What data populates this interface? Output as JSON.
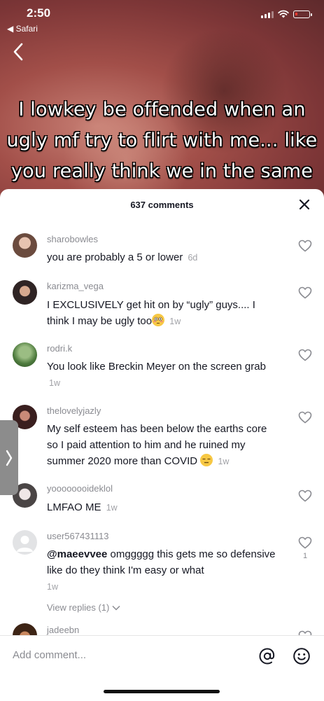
{
  "status_bar": {
    "time": "2:50",
    "back_app": "◀ Safari"
  },
  "video": {
    "caption": "I lowkey be offended when an ugly mf try to flirt with me... like you really think we in the same league?! Tough"
  },
  "comments_sheet": {
    "count_label": "637 comments",
    "comments": [
      {
        "username": "sharobowles",
        "text": "you are probably a 5 or lower",
        "time": "6d"
      },
      {
        "username": "karizma_vega",
        "text": "I EXCLUSIVELY get hit on by “ugly” guys.... I think I may be ugly too",
        "emoji": "flushed-face-emoji",
        "time": "1w"
      },
      {
        "username": "rodri.k",
        "text": "You look like Breckin Meyer on the screen grab",
        "time": "1w"
      },
      {
        "username": "thelovelyjazly",
        "text": "My self esteem has been below the earths core so I paid attention to him and he ruined my summer 2020 more than COVID",
        "emoji": "expressionless-face-emoji",
        "time": "1w"
      },
      {
        "username": "yoooooooideklol",
        "text": "LMFAO ME",
        "time": "1w"
      },
      {
        "username": "user567431113",
        "mention": "@maeevvee",
        "text": " omggggg this gets me so defensive like do they think I'm easy or what",
        "time": "1w",
        "likes": "1"
      },
      {
        "username": "jadeebn"
      }
    ],
    "view_replies": "View replies (1)"
  },
  "input": {
    "placeholder": "Add comment..."
  },
  "icons": {
    "back": "chevron-left-icon",
    "close": "close-icon",
    "like": "heart-outline-icon",
    "mention": "at-sign-icon",
    "emoji": "smiley-icon",
    "side_tab": "chevron-right-icon"
  },
  "colors": {
    "text": "#161823",
    "secondary": "#8a8b91",
    "battery_low": "#ff3b30"
  }
}
